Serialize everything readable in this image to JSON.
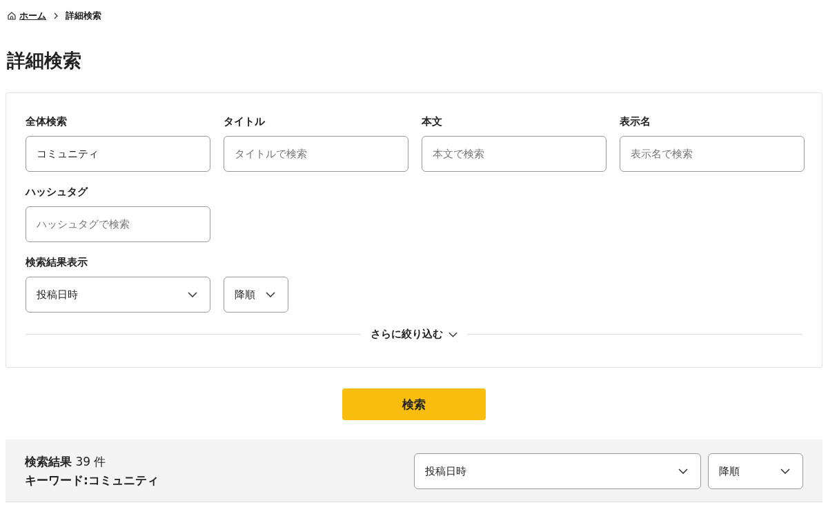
{
  "breadcrumb": [
    {
      "label": "ホーム",
      "kind": "link"
    },
    {
      "label": "詳細検索",
      "kind": "current"
    }
  ],
  "page_title": "詳細検索",
  "search_fields": [
    {
      "label": "全体検索",
      "value": "コミュニティ"
    },
    {
      "label": "タイトル",
      "placeholder": "タイトルで検索"
    },
    {
      "label": "本文",
      "placeholder": "本文で検索"
    },
    {
      "label": "表示名",
      "placeholder": "表示名で検索"
    },
    {
      "label": "ハッシュタグ",
      "placeholder": "ハッシュタグで検索"
    }
  ],
  "result_display": {
    "label": "検索結果表示",
    "sort_field": "投稿日時",
    "sort_order": "降順"
  },
  "refine_toggle": {
    "label": "さらに絞り込む",
    "expanded": false
  },
  "search_button": "検索",
  "results": {
    "summary": "**検索結果** 39 件",
    "keyword": "キーワード:コミュニティ",
    "sort_field": "投稿日時",
    "sort_order": "降順"
  }
}
